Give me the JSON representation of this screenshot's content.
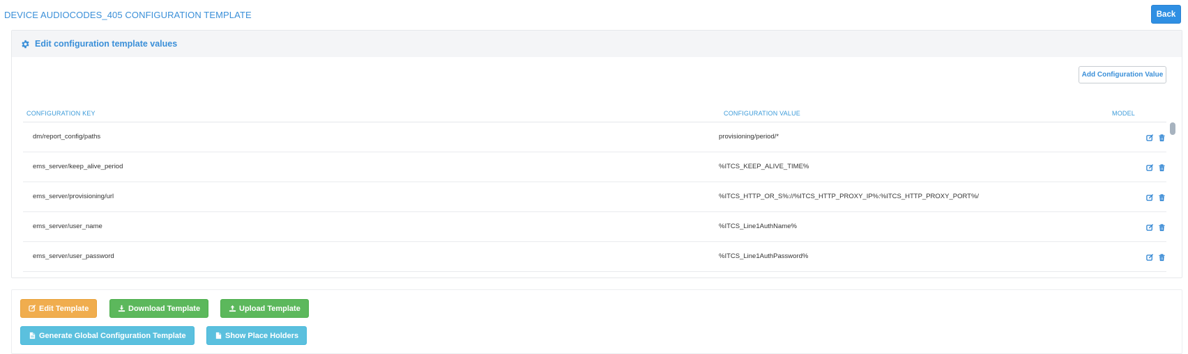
{
  "header": {
    "title": "DEVICE AUDIOCODES_405 CONFIGURATION TEMPLATE",
    "back_label": "Back"
  },
  "panel": {
    "title": "Edit configuration template values",
    "add_label": "Add Configuration Value"
  },
  "table": {
    "columns": [
      "CONFIGURATION KEY",
      "CONFIGURATION VALUE",
      "MODEL"
    ],
    "rows": [
      {
        "key": "dm/report_config/paths",
        "value": "provisioning/period/*"
      },
      {
        "key": "ems_server/keep_alive_period",
        "value": "%ITCS_KEEP_ALIVE_TIME%"
      },
      {
        "key": "ems_server/provisioning/url",
        "value": "%ITCS_HTTP_OR_S%://%ITCS_HTTP_PROXY_IP%:%ITCS_HTTP_PROXY_PORT%/"
      },
      {
        "key": "ems_server/user_name",
        "value": "%ITCS_Line1AuthName%"
      },
      {
        "key": "ems_server/user_password",
        "value": "%ITCS_Line1AuthPassword%"
      }
    ]
  },
  "actions": {
    "edit_template": "Edit Template",
    "download_template": "Download Template",
    "upload_template": "Upload Template",
    "generate_global": "Generate Global Configuration Template",
    "show_placeholders": "Show Place Holders"
  },
  "colors": {
    "accent": "#3a8fd8",
    "back_button": "#2f8fe3",
    "warning": "#f0ad4e",
    "success": "#5cb85c",
    "info": "#5bc0de"
  }
}
